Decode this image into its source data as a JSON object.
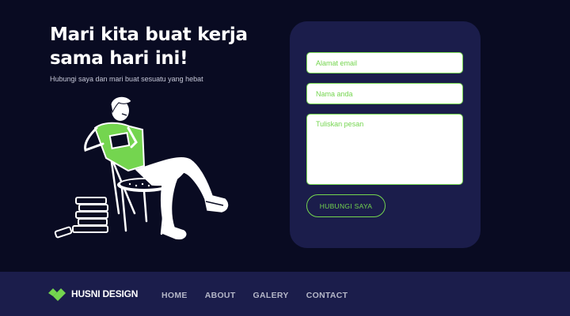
{
  "hero": {
    "title": "Mari kita buat kerja sama hari ini!",
    "subtitle": "Hubungi saya dan mari buat sesuatu yang hebat"
  },
  "form": {
    "email_placeholder": "Alamat email",
    "name_placeholder": "Nama anda",
    "message_placeholder": "Tuliskan pesan",
    "submit_label": "HUBUNGI SAYA"
  },
  "footer": {
    "brand": "HUSNI DESIGN",
    "logo_icon": "chevron-diamond-logo-icon",
    "nav": [
      "HOME",
      "ABOUT",
      "GALERY",
      "CONTACT"
    ]
  },
  "colors": {
    "background": "#090b22",
    "card": "#1b1d4b",
    "accent": "#74d54f",
    "text": "#ffffff"
  }
}
